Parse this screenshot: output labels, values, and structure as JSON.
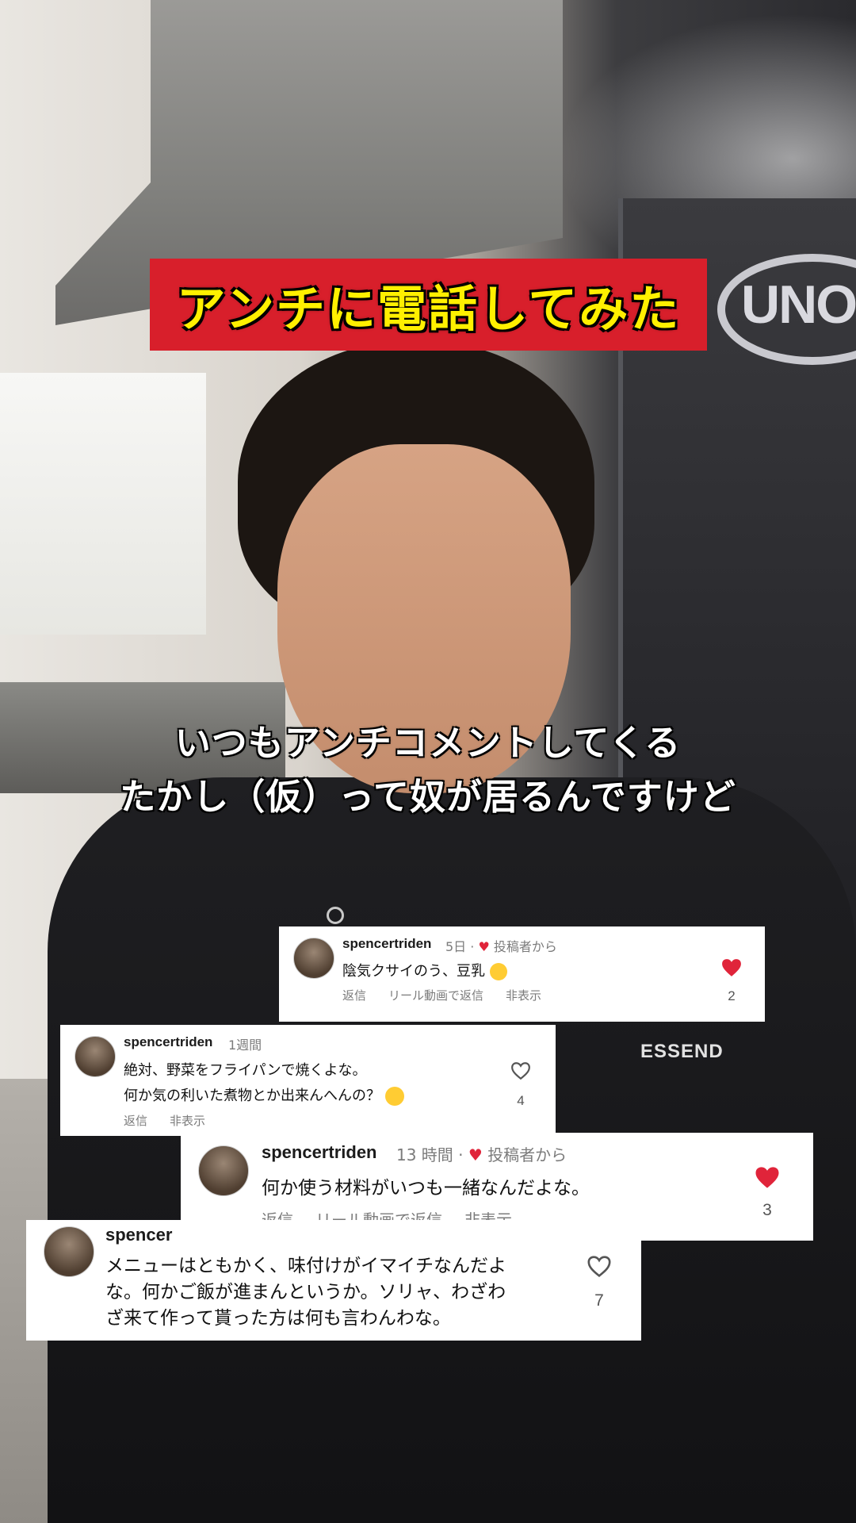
{
  "title": "アンチに電話してみた",
  "brand_texts": {
    "unox": "UNOX",
    "essend": "ESSEND"
  },
  "subtitle": {
    "line1": "いつもアンチコメントしてくる",
    "line2": "たかし（仮）って奴が居るんですけど"
  },
  "comments": [
    {
      "username": "spencertriden",
      "time": "5日",
      "badge": "投稿者から",
      "text_lines": [
        "陰気クサイのう、豆乳"
      ],
      "emoji": "sleepy-face",
      "actions": [
        "返信",
        "リール動画で返信",
        "非表示"
      ],
      "liked": true,
      "likes": "2"
    },
    {
      "username": "spencertriden",
      "time": "1週間",
      "badge": "",
      "text_lines": [
        "絶対、野菜をフライパンで焼くよな。",
        "何か気の利いた煮物とか出来んへんの？"
      ],
      "emoji": "yawning-face",
      "actions": [
        "返信",
        "非表示"
      ],
      "liked": false,
      "likes": "4"
    },
    {
      "username": "spencertriden",
      "time": "13 時間",
      "badge": "投稿者から",
      "text_lines": [
        "何か使う材料がいつも一緒なんだよな。"
      ],
      "emoji": "",
      "actions": [
        "返信",
        "リール動画で返信",
        "非表示"
      ],
      "liked": true,
      "likes": "3"
    },
    {
      "username": "spencer",
      "time": "",
      "badge": "",
      "text_lines": [
        "メニューはともかく、味付けがイマイチなんだよ",
        "な。何かご飯が進まんというか。ソリャ、わざわ",
        "ざ来て作って貰った方は何も言わんわな。"
      ],
      "emoji": "",
      "actions": [],
      "liked": false,
      "likes": "7"
    }
  ],
  "colors": {
    "banner_bg": "#d81f2b",
    "banner_text": "#fff000",
    "heart": "#e0243a"
  }
}
